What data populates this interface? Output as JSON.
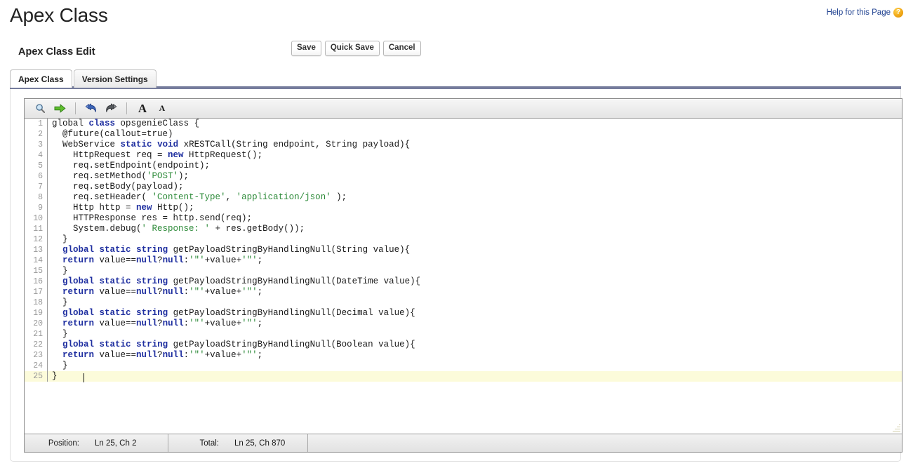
{
  "header": {
    "title": "Apex Class",
    "help_link": "Help for this Page",
    "help_icon_glyph": "?",
    "help_icon_name": "help-question-icon"
  },
  "section": {
    "title": "Apex Class Edit"
  },
  "buttons": [
    {
      "label": "Save",
      "name": "save-button"
    },
    {
      "label": "Quick Save",
      "name": "quick-save-button"
    },
    {
      "label": "Cancel",
      "name": "cancel-button"
    }
  ],
  "tabs": [
    {
      "label": "Apex Class",
      "active": true
    },
    {
      "label": "Version Settings",
      "active": false
    }
  ],
  "editor": {
    "toolbar": [
      {
        "name": "search-icon",
        "title": "Find"
      },
      {
        "name": "go-to-line-arrow-icon",
        "title": "Go To"
      },
      {
        "name": "undo-arrow-icon",
        "title": "Undo"
      },
      {
        "name": "redo-arrow-icon",
        "title": "Redo"
      },
      {
        "name": "increase-font-size-icon",
        "label": "A"
      },
      {
        "name": "decrease-font-size-icon",
        "label": "A"
      }
    ],
    "current_line": 25,
    "lines": [
      {
        "n": 1,
        "tokens": [
          {
            "t": "global",
            "c": "plain"
          },
          {
            "t": " ",
            "c": "plain"
          },
          {
            "t": "class",
            "c": "kw"
          },
          {
            "t": " opsgenieClass {",
            "c": "plain"
          }
        ]
      },
      {
        "n": 2,
        "tokens": [
          {
            "t": "  @future(callout=",
            "c": "plain"
          },
          {
            "t": "true",
            "c": "plain"
          },
          {
            "t": ")",
            "c": "plain"
          }
        ]
      },
      {
        "n": 3,
        "tokens": [
          {
            "t": "  WebService ",
            "c": "plain"
          },
          {
            "t": "static",
            "c": "kw"
          },
          {
            "t": " ",
            "c": "plain"
          },
          {
            "t": "void",
            "c": "kw"
          },
          {
            "t": " xRESTCall(String endpoint, String payload){",
            "c": "plain"
          }
        ]
      },
      {
        "n": 4,
        "tokens": [
          {
            "t": "    HttpRequest req = ",
            "c": "plain"
          },
          {
            "t": "new",
            "c": "kw"
          },
          {
            "t": " HttpRequest();",
            "c": "plain"
          }
        ]
      },
      {
        "n": 5,
        "tokens": [
          {
            "t": "    req.setEndpoint(endpoint);",
            "c": "plain"
          }
        ]
      },
      {
        "n": 6,
        "tokens": [
          {
            "t": "    req.setMethod(",
            "c": "plain"
          },
          {
            "t": "'POST'",
            "c": "str"
          },
          {
            "t": ");",
            "c": "plain"
          }
        ]
      },
      {
        "n": 7,
        "tokens": [
          {
            "t": "    req.setBody(payload);",
            "c": "plain"
          }
        ]
      },
      {
        "n": 8,
        "tokens": [
          {
            "t": "    req.setHeader( ",
            "c": "plain"
          },
          {
            "t": "'Content-Type'",
            "c": "str"
          },
          {
            "t": ", ",
            "c": "plain"
          },
          {
            "t": "'application/json'",
            "c": "str"
          },
          {
            "t": " );",
            "c": "plain"
          }
        ]
      },
      {
        "n": 9,
        "tokens": [
          {
            "t": "    Http http = ",
            "c": "plain"
          },
          {
            "t": "new",
            "c": "kw"
          },
          {
            "t": " Http();",
            "c": "plain"
          }
        ]
      },
      {
        "n": 10,
        "tokens": [
          {
            "t": "    HTTPResponse res = http.send(req);",
            "c": "plain"
          }
        ]
      },
      {
        "n": 11,
        "tokens": [
          {
            "t": "    System.debug(",
            "c": "plain"
          },
          {
            "t": "' Response: '",
            "c": "str"
          },
          {
            "t": " + res.getBody());",
            "c": "plain"
          }
        ]
      },
      {
        "n": 12,
        "tokens": [
          {
            "t": "  }",
            "c": "plain"
          }
        ]
      },
      {
        "n": 13,
        "tokens": [
          {
            "t": "  ",
            "c": "plain"
          },
          {
            "t": "global",
            "c": "kw"
          },
          {
            "t": " ",
            "c": "plain"
          },
          {
            "t": "static",
            "c": "kw"
          },
          {
            "t": " ",
            "c": "plain"
          },
          {
            "t": "string",
            "c": "kw"
          },
          {
            "t": " getPayloadStringByHandlingNull(String value){",
            "c": "plain"
          }
        ]
      },
      {
        "n": 14,
        "tokens": [
          {
            "t": "  ",
            "c": "plain"
          },
          {
            "t": "return",
            "c": "kw"
          },
          {
            "t": " value==",
            "c": "plain"
          },
          {
            "t": "null",
            "c": "kw"
          },
          {
            "t": "?",
            "c": "plain"
          },
          {
            "t": "null",
            "c": "kw"
          },
          {
            "t": ":",
            "c": "plain"
          },
          {
            "t": "'\"'",
            "c": "str"
          },
          {
            "t": "+value+",
            "c": "plain"
          },
          {
            "t": "'\"'",
            "c": "str"
          },
          {
            "t": ";",
            "c": "plain"
          }
        ]
      },
      {
        "n": 15,
        "tokens": [
          {
            "t": "  }",
            "c": "plain"
          }
        ]
      },
      {
        "n": 16,
        "tokens": [
          {
            "t": "  ",
            "c": "plain"
          },
          {
            "t": "global",
            "c": "kw"
          },
          {
            "t": " ",
            "c": "plain"
          },
          {
            "t": "static",
            "c": "kw"
          },
          {
            "t": " ",
            "c": "plain"
          },
          {
            "t": "string",
            "c": "kw"
          },
          {
            "t": " getPayloadStringByHandlingNull(DateTime value){",
            "c": "plain"
          }
        ]
      },
      {
        "n": 17,
        "tokens": [
          {
            "t": "  ",
            "c": "plain"
          },
          {
            "t": "return",
            "c": "kw"
          },
          {
            "t": " value==",
            "c": "plain"
          },
          {
            "t": "null",
            "c": "kw"
          },
          {
            "t": "?",
            "c": "plain"
          },
          {
            "t": "null",
            "c": "kw"
          },
          {
            "t": ":",
            "c": "plain"
          },
          {
            "t": "'\"'",
            "c": "str"
          },
          {
            "t": "+value+",
            "c": "plain"
          },
          {
            "t": "'\"'",
            "c": "str"
          },
          {
            "t": ";",
            "c": "plain"
          }
        ]
      },
      {
        "n": 18,
        "tokens": [
          {
            "t": "  }",
            "c": "plain"
          }
        ]
      },
      {
        "n": 19,
        "tokens": [
          {
            "t": "  ",
            "c": "plain"
          },
          {
            "t": "global",
            "c": "kw"
          },
          {
            "t": " ",
            "c": "plain"
          },
          {
            "t": "static",
            "c": "kw"
          },
          {
            "t": " ",
            "c": "plain"
          },
          {
            "t": "string",
            "c": "kw"
          },
          {
            "t": " getPayloadStringByHandlingNull(Decimal value){",
            "c": "plain"
          }
        ]
      },
      {
        "n": 20,
        "tokens": [
          {
            "t": "  ",
            "c": "plain"
          },
          {
            "t": "return",
            "c": "kw"
          },
          {
            "t": " value==",
            "c": "plain"
          },
          {
            "t": "null",
            "c": "kw"
          },
          {
            "t": "?",
            "c": "plain"
          },
          {
            "t": "null",
            "c": "kw"
          },
          {
            "t": ":",
            "c": "plain"
          },
          {
            "t": "'\"'",
            "c": "str"
          },
          {
            "t": "+value+",
            "c": "plain"
          },
          {
            "t": "'\"'",
            "c": "str"
          },
          {
            "t": ";",
            "c": "plain"
          }
        ]
      },
      {
        "n": 21,
        "tokens": [
          {
            "t": "  }",
            "c": "plain"
          }
        ]
      },
      {
        "n": 22,
        "tokens": [
          {
            "t": "  ",
            "c": "plain"
          },
          {
            "t": "global",
            "c": "kw"
          },
          {
            "t": " ",
            "c": "plain"
          },
          {
            "t": "static",
            "c": "kw"
          },
          {
            "t": " ",
            "c": "plain"
          },
          {
            "t": "string",
            "c": "kw"
          },
          {
            "t": " getPayloadStringByHandlingNull(Boolean value){",
            "c": "plain"
          }
        ]
      },
      {
        "n": 23,
        "tokens": [
          {
            "t": "  ",
            "c": "plain"
          },
          {
            "t": "return",
            "c": "kw"
          },
          {
            "t": " value==",
            "c": "plain"
          },
          {
            "t": "null",
            "c": "kw"
          },
          {
            "t": "?",
            "c": "plain"
          },
          {
            "t": "null",
            "c": "kw"
          },
          {
            "t": ":",
            "c": "plain"
          },
          {
            "t": "'\"'",
            "c": "str"
          },
          {
            "t": "+value+",
            "c": "plain"
          },
          {
            "t": "'\"'",
            "c": "str"
          },
          {
            "t": ";",
            "c": "plain"
          }
        ]
      },
      {
        "n": 24,
        "tokens": [
          {
            "t": "  }",
            "c": "plain"
          }
        ]
      },
      {
        "n": 25,
        "tokens": [
          {
            "t": "}",
            "c": "plain"
          }
        ]
      }
    ]
  },
  "status_bar": {
    "position_label": "Position:",
    "position_value": "Ln 25, Ch 2",
    "total_label": "Total:",
    "total_value": "Ln 25, Ch 870"
  },
  "colors": {
    "keyword": "#1f2fa0",
    "string": "#2e8b3a",
    "link": "#1d3f8f",
    "tab_bar": "#757c9c",
    "current_line": "#fcfbda",
    "help_icon": "#f0a818"
  }
}
